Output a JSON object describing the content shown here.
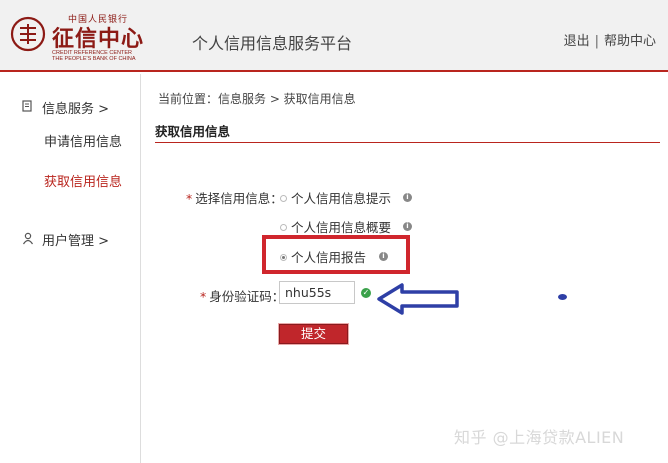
{
  "header": {
    "logo": {
      "top_text": "中国人民银行",
      "main_text": "征信中心",
      "en_line1": "CREDIT REFERENCE CENTER",
      "en_line2": "THE PEOPLE'S BANK OF CHINA"
    },
    "site_title": "个人信用信息服务平台",
    "links": {
      "logout": "退出",
      "separator": "|",
      "help": "帮助中心"
    }
  },
  "sidebar": {
    "groups": [
      {
        "label": "信息服务 >",
        "icon": "document-icon",
        "items": [
          {
            "label": "申请信用信息",
            "active": false
          },
          {
            "label": "获取信用信息",
            "active": true
          }
        ]
      },
      {
        "label": "用户管理 >",
        "icon": "user-icon",
        "items": []
      }
    ]
  },
  "main": {
    "breadcrumb": "当前位置：信息服务 > 获取信用信息",
    "section_title": "获取信用信息",
    "form": {
      "select_label": "选择信用信息：",
      "required_mark": "*",
      "options": [
        {
          "label": "个人信用信息提示",
          "checked": false
        },
        {
          "label": "个人信用信息概要",
          "checked": false
        },
        {
          "label": "个人信用报告",
          "checked": true
        }
      ],
      "code_label": "身份验证码：",
      "code_value": "nhu55s",
      "submit_label": "提交"
    }
  },
  "annotation": {
    "highlight_color": "#d0262d",
    "arrow_color": "#2e3fa6"
  },
  "watermark": "知乎 @上海贷款ALIEN",
  "colors": {
    "accent": "#b9251e",
    "success": "#3aa14a"
  }
}
